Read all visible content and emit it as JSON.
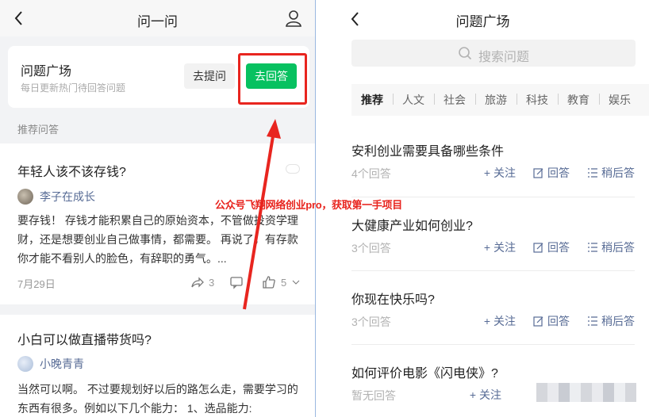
{
  "left": {
    "header": {
      "title": "问一问"
    },
    "square_card": {
      "title": "问题广场",
      "subtitle": "每日更新热门待回答问题",
      "ask_label": "去提问",
      "answer_label": "去回答"
    },
    "section_label": "推荐问答",
    "questions": [
      {
        "title": "年轻人该不该存钱?",
        "author": "李子在成长",
        "body": "要存钱！ 存钱才能积累自己的原始资本，不管做投资学理财，还是想要创业自己做事情，都需要。 再说了，有存款你才能不看别人的脸色，有辞职的勇气。...",
        "date": "7月29日",
        "shares": "3",
        "likes": "5"
      },
      {
        "title": "小白可以做直播带货吗?",
        "author": "小晚青青",
        "body": "当然可以啊。 不过要规划好以后的路怎么走，需要学习的东西有很多。例如以下几个能力： 1、选品能力:"
      }
    ]
  },
  "annotation": {
    "text": "公众号飞翔网络创业pro，获取第一手项目",
    "color": "#e8251f"
  },
  "right": {
    "header": {
      "title": "问题广场"
    },
    "search": {
      "placeholder": "搜索问题"
    },
    "tabs": [
      "推荐",
      "人文",
      "社会",
      "旅游",
      "科技",
      "教育",
      "娱乐"
    ],
    "active_tab": "推荐",
    "items": [
      {
        "question": "安利创业需要具备哪些条件",
        "count": "4个回答",
        "follow": "+ 关注",
        "answer": "回答",
        "later": "稍后答"
      },
      {
        "question": "大健康产业如何创业?",
        "count": "3个回答",
        "follow": "+ 关注",
        "answer": "回答",
        "later": "稍后答"
      },
      {
        "question": "你现在快乐吗?",
        "count": "3个回答",
        "follow": "+ 关注",
        "answer": "回答",
        "later": "稍后答"
      },
      {
        "question": "如何评价电影《闪电侠》?",
        "count": "暂无回答",
        "follow": "+ 关注"
      }
    ]
  },
  "colors": {
    "accent_green": "#07c160",
    "link_blue": "#576b95",
    "highlight_red": "#e8251f"
  }
}
